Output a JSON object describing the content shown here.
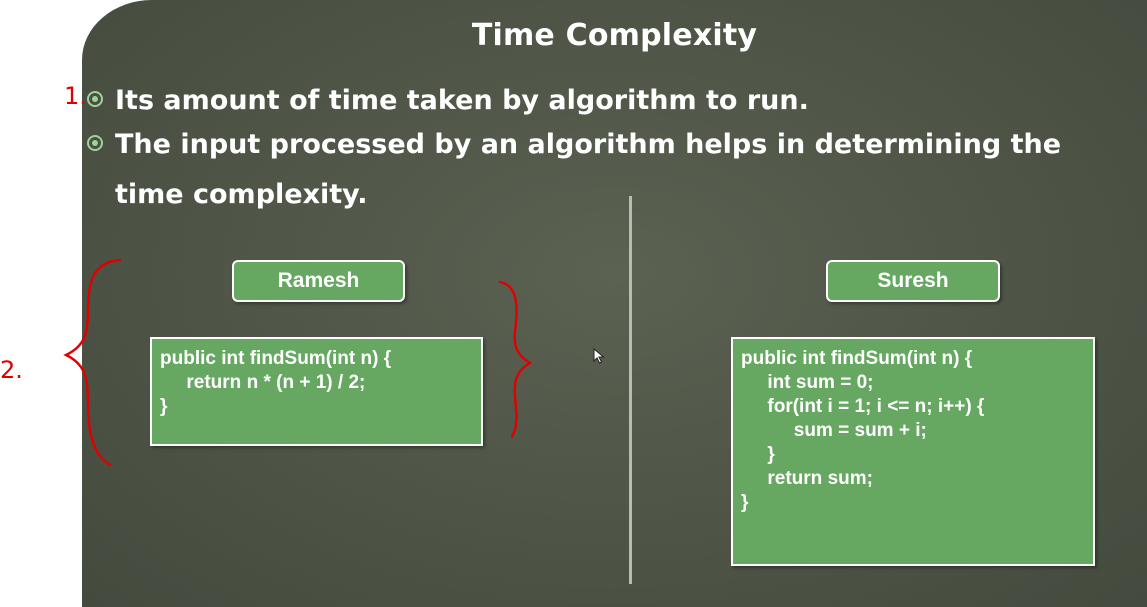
{
  "slide": {
    "title": "Time Complexity",
    "bullets": [
      {
        "text": "Its amount of time taken by algorithm to run."
      },
      {
        "text": "The input processed by an algorithm helps in determining the",
        "continuation": "time complexity."
      }
    ]
  },
  "ramesh": {
    "label": "Ramesh",
    "code_lines": [
      "public int findSum(int n) {",
      "     return n * (n + 1) / 2;",
      "}"
    ]
  },
  "suresh": {
    "label": "Suresh",
    "code_lines": [
      "public int findSum(int n) {",
      "     int sum = 0;",
      "     for(int i = 1; i <= n; i++) {",
      "          sum = sum + i;",
      "     }",
      "     return sum;",
      "}"
    ]
  },
  "annotations": {
    "margin_mark_1": "1.",
    "margin_mark_2": "2."
  },
  "colors": {
    "box_fill": "#66a862",
    "ink": "#e00000",
    "bullet": "#9fd29a"
  }
}
